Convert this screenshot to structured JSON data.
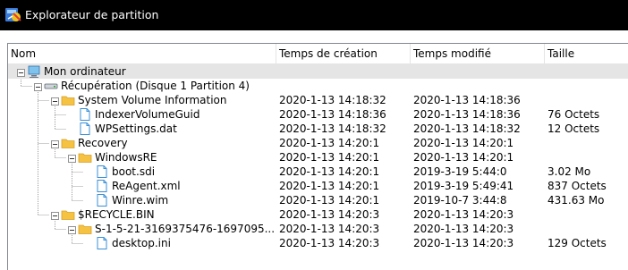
{
  "window": {
    "title": "Explorateur de partition"
  },
  "columns": [
    {
      "label": "Nom"
    },
    {
      "label": "Temps de création"
    },
    {
      "label": "Temps modifié"
    },
    {
      "label": "Taille"
    }
  ],
  "rows": [
    {
      "name": "Mon ordinateur",
      "icon": "computer-icon",
      "created": "",
      "modified": "",
      "size": ""
    },
    {
      "name": "Récupération (Disque 1 Partition 4)",
      "icon": "drive-icon",
      "created": "",
      "modified": "",
      "size": ""
    },
    {
      "name": "System Volume Information",
      "icon": "folder-icon",
      "created": "2020-1-13 14:18:32",
      "modified": "2020-1-13 14:18:36",
      "size": ""
    },
    {
      "name": "IndexerVolumeGuid",
      "icon": "file-icon",
      "created": "2020-1-13 14:18:36",
      "modified": "2020-1-13 14:18:36",
      "size": "76 Octets"
    },
    {
      "name": "WPSettings.dat",
      "icon": "file-icon",
      "created": "2020-1-13 14:18:32",
      "modified": "2020-1-13 14:18:32",
      "size": "12 Octets"
    },
    {
      "name": "Recovery",
      "icon": "folder-icon",
      "created": "2020-1-13 14:20:1",
      "modified": "2020-1-13 14:20:1",
      "size": ""
    },
    {
      "name": "WindowsRE",
      "icon": "folder-icon",
      "created": "2020-1-13 14:20:1",
      "modified": "2020-1-13 14:20:1",
      "size": ""
    },
    {
      "name": "boot.sdi",
      "icon": "file-icon",
      "created": "2020-1-13 14:20:1",
      "modified": "2019-3-19 5:44:0",
      "size": "3.02 Mo"
    },
    {
      "name": "ReAgent.xml",
      "icon": "file-icon",
      "created": "2020-1-13 14:20:1",
      "modified": "2019-3-19 5:49:41",
      "size": "837 Octets"
    },
    {
      "name": "Winre.wim",
      "icon": "file-icon",
      "created": "2020-1-13 14:20:1",
      "modified": "2019-10-7 3:44:8",
      "size": "431.63 Mo"
    },
    {
      "name": "$RECYCLE.BIN",
      "icon": "folder-icon",
      "created": "2020-1-13 14:20:3",
      "modified": "2020-1-13 14:20:3",
      "size": ""
    },
    {
      "name": "S-1-5-21-3169375476-1697095...",
      "icon": "folder-icon",
      "created": "2020-1-13 14:20:3",
      "modified": "2020-1-13 14:20:3",
      "size": ""
    },
    {
      "name": "desktop.ini",
      "icon": "file-icon",
      "created": "2020-1-13 14:20:3",
      "modified": "2020-1-13 14:20:3",
      "size": "129 Octets"
    }
  ],
  "colors": {
    "folder": "#f5c242",
    "file": "#3a8fd6",
    "selection": "#e5e5e5"
  }
}
